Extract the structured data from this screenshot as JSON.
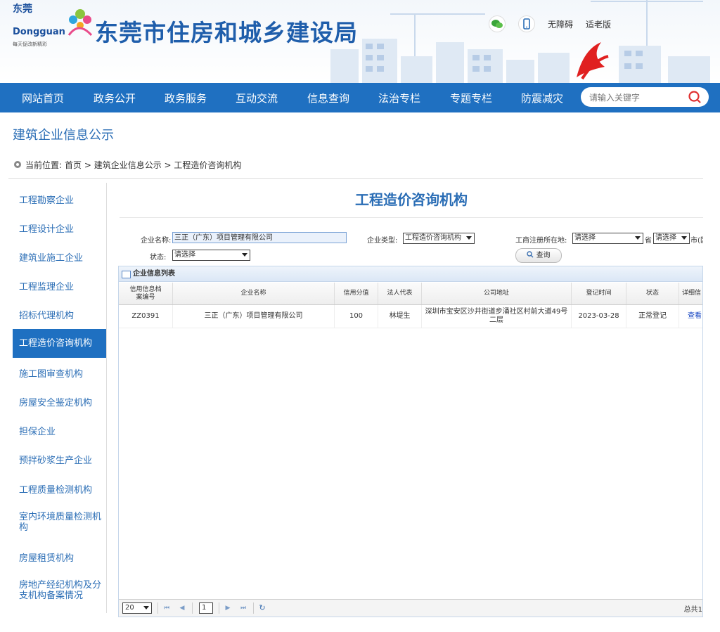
{
  "header": {
    "logo_cn": "东莞",
    "logo_en": "Dongguan",
    "logo_slogan": "每天促改新精彩",
    "site_title": "东莞市住房和城乡建设局",
    "tools": {
      "accessible": "无障碍",
      "elderly": "适老版"
    }
  },
  "nav": {
    "items": [
      "网站首页",
      "政务公开",
      "政务服务",
      "互动交流",
      "信息查询",
      "法治专栏",
      "专题专栏",
      "防震减灾"
    ],
    "search_placeholder": "请输入关键字"
  },
  "page": {
    "section_title": "建筑企业信息公示",
    "breadcrumb": {
      "label": "当前位置:",
      "path": "首页 > 建筑企业信息公示 > 工程造价咨询机构"
    }
  },
  "sidebar": {
    "items": [
      {
        "label": "工程勘察企业"
      },
      {
        "label": "工程设计企业"
      },
      {
        "label": "建筑业施工企业"
      },
      {
        "label": "工程监理企业"
      },
      {
        "label": "招标代理机构"
      },
      {
        "label": "工程造价咨询机构",
        "active": true
      },
      {
        "label": "施工图审查机构"
      },
      {
        "label": "房屋安全鉴定机构"
      },
      {
        "label": "担保企业"
      },
      {
        "label": "预拌砂浆生产企业"
      },
      {
        "label": "工程质量检测机构"
      },
      {
        "label": "室内环境质量检测机构"
      },
      {
        "label": "房屋租赁机构"
      },
      {
        "label": "房地产经纪机构及分支机构备案情况"
      }
    ]
  },
  "main": {
    "title": "工程造价咨询机构",
    "form": {
      "name_label": "企业名称:",
      "name_value": "三正（广东）项目管理有限公司",
      "type_label": "企业类型:",
      "type_value": "工程造价咨询机构",
      "reg_label": "工商注册所在地:",
      "reg_province": "请选择",
      "province_suffix": "省",
      "reg_city": "请选择",
      "city_suffix": "市(区",
      "status_label": "状态:",
      "status_value": "请选择",
      "query_button": "查询"
    },
    "grid": {
      "title": "企业信息列表",
      "columns": [
        "信用信息档案编号",
        "企业名称",
        "信用分值",
        "法人代表",
        "公司地址",
        "登记时间",
        "状态",
        "详细信"
      ],
      "rows": [
        {
          "code": "ZZ0391",
          "name": "三正（广东）项目管理有限公司",
          "score": "100",
          "legal": "林堤生",
          "address": "深圳市宝安区沙井街道步涌社区村前大道49号二层",
          "date": "2023-03-28",
          "status": "正常登记",
          "detail": "查看"
        }
      ],
      "pager": {
        "page_size": "20",
        "page": "1",
        "total": "总共1"
      }
    }
  },
  "colors": {
    "primary": "#1f70c1",
    "title": "#1f5eab",
    "link": "#2a6db5"
  }
}
